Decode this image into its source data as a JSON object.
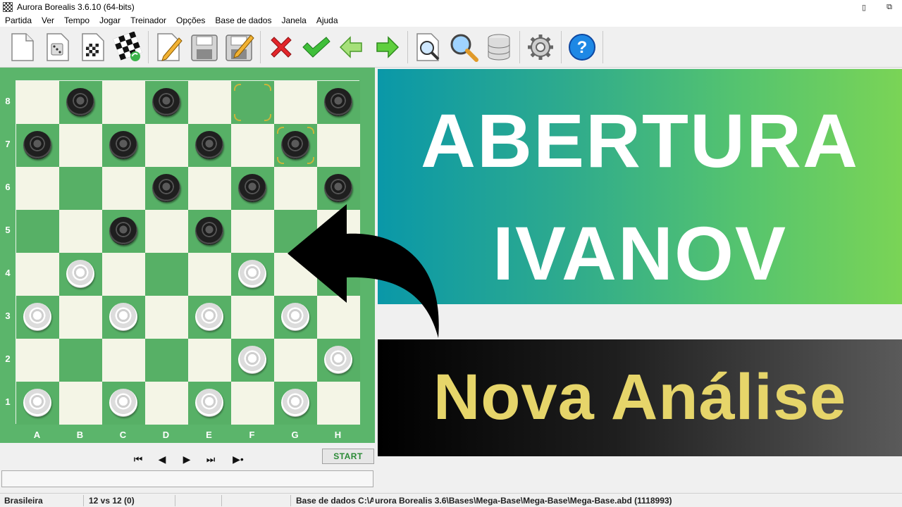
{
  "window": {
    "title": "Aurora Borealis 3.6.10 (64-bits)",
    "minimize_glyph": "▯",
    "restore_glyph": "⧉"
  },
  "menu": [
    "Partida",
    "Ver",
    "Tempo",
    "Jogar",
    "Treinador",
    "Opções",
    "Base de dados",
    "Janela",
    "Ajuda"
  ],
  "toolbar": {
    "buttons": [
      "new-game-icon",
      "random-dice-icon",
      "board-setup-icon",
      "flip-board-icon",
      "edit-icon",
      "save-icon",
      "save-edit-icon",
      "cancel-icon",
      "confirm-icon",
      "back-arrow-icon",
      "forward-arrow-icon",
      "search-document-icon",
      "magnifier-icon",
      "database-icon",
      "gear-icon",
      "help-icon"
    ]
  },
  "board": {
    "files": [
      "A",
      "B",
      "C",
      "D",
      "E",
      "F",
      "G",
      "H"
    ],
    "ranks": [
      "8",
      "7",
      "6",
      "5",
      "4",
      "3",
      "2",
      "1"
    ],
    "pieces": [
      {
        "square": "b8",
        "color": "black"
      },
      {
        "square": "d8",
        "color": "black"
      },
      {
        "square": "h8",
        "color": "black"
      },
      {
        "square": "a7",
        "color": "black"
      },
      {
        "square": "c7",
        "color": "black"
      },
      {
        "square": "e7",
        "color": "black"
      },
      {
        "square": "g7",
        "color": "black"
      },
      {
        "square": "d6",
        "color": "black"
      },
      {
        "square": "f6",
        "color": "black"
      },
      {
        "square": "h6",
        "color": "black"
      },
      {
        "square": "c5",
        "color": "black"
      },
      {
        "square": "e5",
        "color": "black"
      },
      {
        "square": "b4",
        "color": "white"
      },
      {
        "square": "f4",
        "color": "white"
      },
      {
        "square": "a3",
        "color": "white"
      },
      {
        "square": "c3",
        "color": "white"
      },
      {
        "square": "e3",
        "color": "white"
      },
      {
        "square": "g3",
        "color": "white"
      },
      {
        "square": "f2",
        "color": "white"
      },
      {
        "square": "h2",
        "color": "white"
      },
      {
        "square": "a1",
        "color": "white"
      },
      {
        "square": "c1",
        "color": "white"
      },
      {
        "square": "e1",
        "color": "white"
      },
      {
        "square": "g1",
        "color": "white"
      }
    ],
    "last_move": [
      "f8",
      "g7"
    ]
  },
  "navigation": {
    "first": "⏮",
    "prev": "◀",
    "next": "▶",
    "last": "⏭",
    "engine": "▶•",
    "start_label": "START"
  },
  "status": {
    "variant": "Brasileira",
    "score": "12 vs 12  (0)",
    "database_prefix": "Base de dados C:\\Au",
    "database_path": "urora Borealis 3.6\\Bases\\Mega-Base\\Mega-Base\\Mega-Base.abd (1118993)"
  },
  "thumbnail": {
    "title_line1": "ABERTURA",
    "title_line2": "IVANOV",
    "subtitle": "Nova Análise",
    "colors": {
      "subtitle": "#e6d56a",
      "banner_start": "#0a98a8",
      "banner_end": "#7ad456"
    }
  }
}
